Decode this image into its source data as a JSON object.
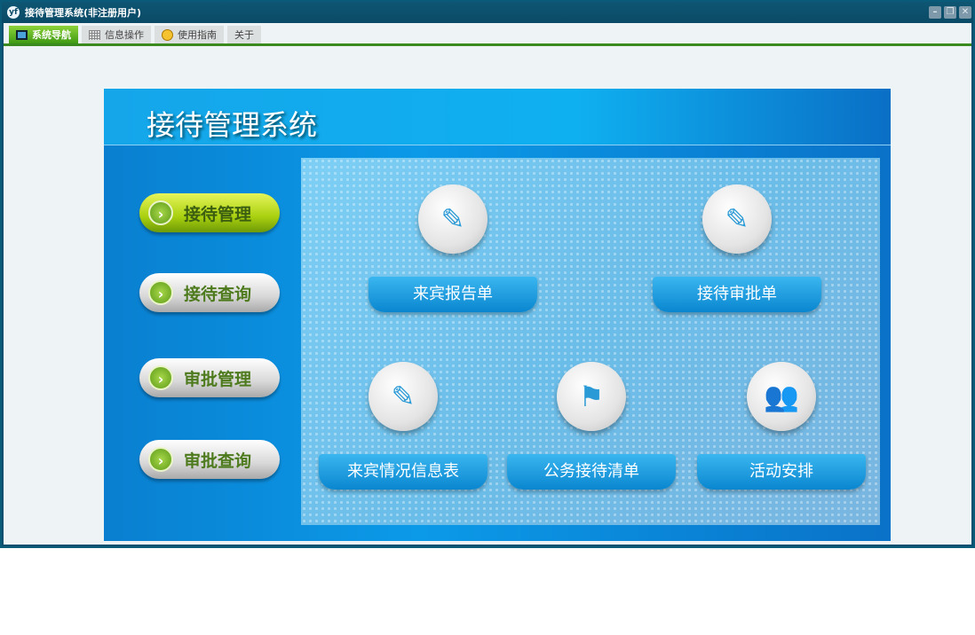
{
  "window": {
    "title": "接待管理系统(非注册用户)",
    "logo": "yf",
    "controls": [
      "minimize",
      "restore",
      "close"
    ]
  },
  "tabs": [
    {
      "label": "系统导航",
      "icon": "monitor-icon"
    },
    {
      "label": "信息操作",
      "icon": "grid-icon"
    },
    {
      "label": "使用指南",
      "icon": "help-icon"
    },
    {
      "label": "关于"
    }
  ],
  "panel": {
    "title": "接待管理系统",
    "menu": [
      "接待管理",
      "接待查询",
      "审批管理",
      "审批查询"
    ],
    "items": [
      {
        "label": "来宾报告单",
        "icon": "form-edit-icon"
      },
      {
        "label": "接待审批单",
        "icon": "form-edit-icon"
      },
      {
        "label": "来宾情况信息表",
        "icon": "form-edit-icon"
      },
      {
        "label": "公务接待清单",
        "icon": "flag-icon"
      },
      {
        "label": "活动安排",
        "icon": "users-icon"
      }
    ]
  }
}
